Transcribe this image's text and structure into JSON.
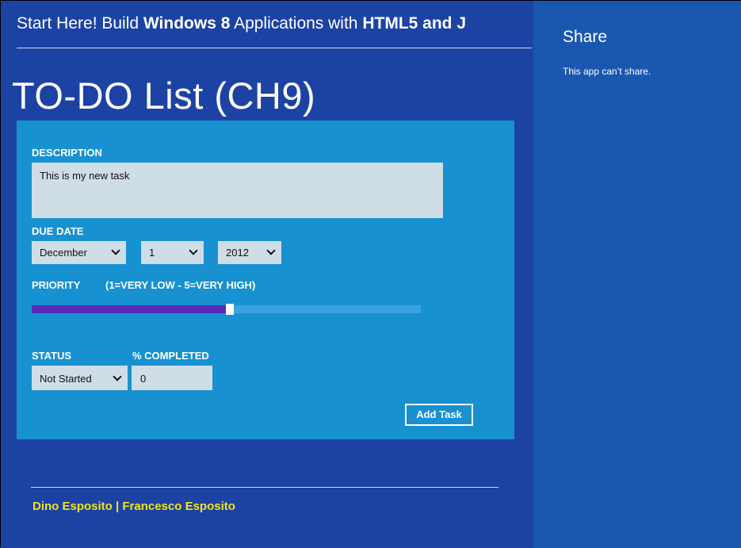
{
  "header": {
    "title_parts": [
      {
        "text": "Start Here! Build ",
        "bold": false
      },
      {
        "text": "Windows 8",
        "bold": true
      },
      {
        "text": " Applications with ",
        "bold": false
      },
      {
        "text": "HTML5",
        "bold": true
      },
      {
        "text": " and J",
        "bold": true
      }
    ]
  },
  "page_title": "TO-DO List (CH9)",
  "form": {
    "description_label": "DESCRIPTION",
    "description_value": "This is my new task",
    "due_date_label": "DUE DATE",
    "month": "December",
    "day": "1",
    "year": "2012",
    "priority_label": "PRIORITY",
    "priority_hint": "(1=VERY LOW - 5=VERY HIGH)",
    "priority_fraction": 0.5,
    "status_label": "STATUS",
    "status_value": "Not Started",
    "percent_label": "% COMPLETED",
    "percent_value": "0",
    "add_task_label": "Add Task"
  },
  "footer": {
    "authors": "Dino Esposito | Francesco Esposito"
  },
  "share_pane": {
    "title": "Share",
    "message": "This app can’t share."
  },
  "colors": {
    "app_background": "#1c43a3",
    "panel_background": "#1891d1",
    "slider_fill": "#5a2ab8",
    "footer_text": "#f3e318",
    "share_background": "#1a57b0"
  }
}
